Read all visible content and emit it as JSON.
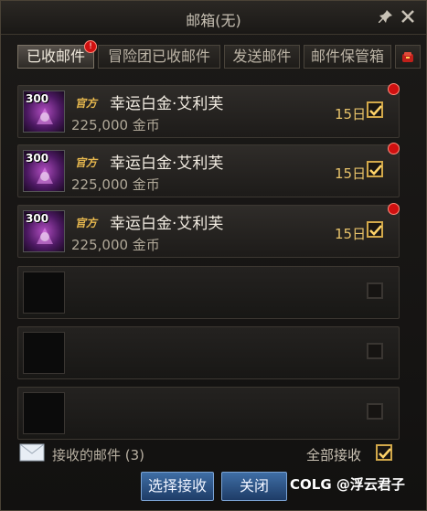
{
  "window": {
    "title": "邮箱(无)"
  },
  "tabs": [
    {
      "label": "已收邮件",
      "active": true,
      "badge": "!"
    },
    {
      "label": "冒险团已收邮件",
      "active": false
    },
    {
      "label": "发送邮件",
      "active": false
    },
    {
      "label": "邮件保管箱",
      "active": false
    }
  ],
  "mails": [
    {
      "item_level": "300",
      "official_tag": "官方",
      "sender": "幸运白金·艾利芙",
      "gold": "225,000 金币",
      "days_left": "15日",
      "checked": true,
      "unread": true
    },
    {
      "item_level": "300",
      "official_tag": "官方",
      "sender": "幸运白金·艾利芙",
      "gold": "225,000 金币",
      "days_left": "15日",
      "checked": true,
      "unread": true
    },
    {
      "item_level": "300",
      "official_tag": "官方",
      "sender": "幸运白金·艾利芙",
      "gold": "225,000 金币",
      "days_left": "15日",
      "checked": true,
      "unread": true
    }
  ],
  "footer": {
    "received_label": "接收的邮件 (3)",
    "select_all_label": "全部接收",
    "select_all_checked": true
  },
  "buttons": {
    "select_receive": "选择接收",
    "close": "关闭"
  },
  "watermark": "COLG @浮云君子",
  "colors": {
    "accent_gold": "#d2a84a",
    "button_blue": "#2f5a8e",
    "badge_red": "#d01010"
  }
}
